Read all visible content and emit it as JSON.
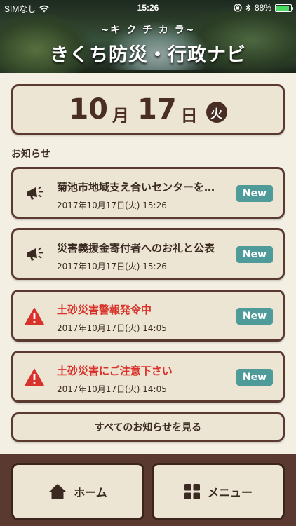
{
  "status_bar": {
    "carrier": "SIMなし",
    "time": "15:26",
    "battery": "88%",
    "battery_level": 0.88
  },
  "header": {
    "subtitle": "~キ ク チ カ ラ~",
    "title": "きくち防災・行政ナビ"
  },
  "date": {
    "month": "10",
    "month_unit": "月",
    "day": "17",
    "day_unit": "日",
    "weekday": "火"
  },
  "news_section": {
    "title": "お知らせ",
    "items": [
      {
        "icon": "megaphone-icon",
        "title": "菊池市地域支え合いセンターを…",
        "date": "2017年10月17日(火) 15:26",
        "badge": "New",
        "alert": false
      },
      {
        "icon": "megaphone-icon",
        "title": "災害義援金寄付者へのお礼と公表",
        "date": "2017年10月17日(火) 15:26",
        "badge": "New",
        "alert": false
      },
      {
        "icon": "warning-icon",
        "title": "土砂災害警報発令中",
        "date": "2017年10月17日(火) 14:05",
        "badge": "New",
        "alert": true
      },
      {
        "icon": "warning-icon",
        "title": "土砂災害にご注意下さい",
        "date": "2017年10月17日(火) 14:05",
        "badge": "New",
        "alert": true
      }
    ],
    "view_all_label": "すべてのお知らせを見る"
  },
  "bottom_nav": {
    "home_label": "ホーム",
    "menu_label": "メニュー"
  },
  "colors": {
    "brown": "#5a3a30",
    "card_bg": "#ece5d3",
    "page_bg": "#f3efe3",
    "badge": "#4e9b9a",
    "alert": "#d8322a"
  }
}
